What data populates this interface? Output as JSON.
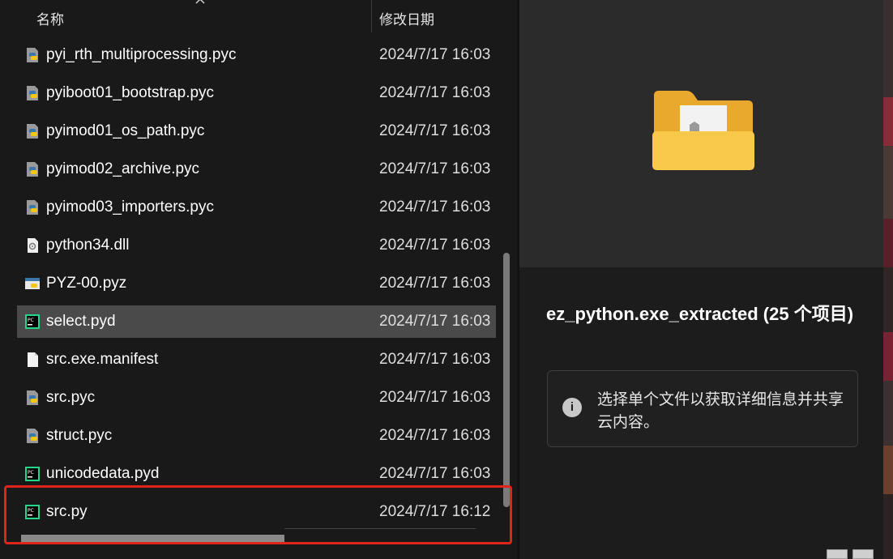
{
  "header": {
    "col_name": "名称",
    "col_date": "修改日期"
  },
  "files": [
    {
      "name": "pyi_rth_multiprocessing.pyc",
      "date": "2024/7/17 16:03",
      "icon": "python-file-icon"
    },
    {
      "name": "pyiboot01_bootstrap.pyc",
      "date": "2024/7/17 16:03",
      "icon": "python-file-icon"
    },
    {
      "name": "pyimod01_os_path.pyc",
      "date": "2024/7/17 16:03",
      "icon": "python-file-icon"
    },
    {
      "name": "pyimod02_archive.pyc",
      "date": "2024/7/17 16:03",
      "icon": "python-file-icon"
    },
    {
      "name": "pyimod03_importers.pyc",
      "date": "2024/7/17 16:03",
      "icon": "python-file-icon"
    },
    {
      "name": "python34.dll",
      "date": "2024/7/17 16:03",
      "icon": "dll-file-icon"
    },
    {
      "name": "PYZ-00.pyz",
      "date": "2024/7/17 16:03",
      "icon": "pyz-file-icon"
    },
    {
      "name": "select.pyd",
      "date": "2024/7/17 16:03",
      "icon": "pycharm-file-icon"
    },
    {
      "name": "src.exe.manifest",
      "date": "2024/7/17 16:03",
      "icon": "blank-file-icon"
    },
    {
      "name": "src.pyc",
      "date": "2024/7/17 16:03",
      "icon": "python-file-icon"
    },
    {
      "name": "struct.pyc",
      "date": "2024/7/17 16:03",
      "icon": "python-file-icon"
    },
    {
      "name": "unicodedata.pyd",
      "date": "2024/7/17 16:03",
      "icon": "pycharm-file-icon"
    },
    {
      "name": "src.py",
      "date": "2024/7/17 16:12",
      "icon": "pycharm-file-icon"
    }
  ],
  "preview": {
    "title": "ez_python.exe_extracted (25 个项目)",
    "info_icon": "info-icon",
    "info_text": "选择单个文件以获取详细信息并共享云内容。"
  },
  "colors": {
    "background": "#191919",
    "selected_row": "#4a4a4a",
    "highlight_border": "#e0241c",
    "folder_yellow": "#f8c94a"
  }
}
